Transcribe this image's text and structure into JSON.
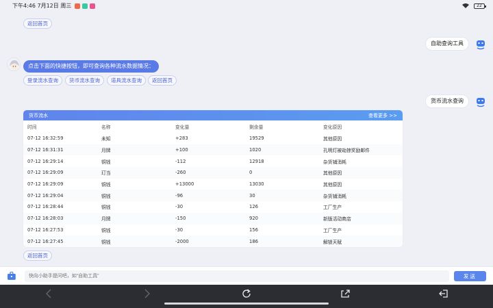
{
  "statusbar": {
    "time": "下午4:46 7月12日 周三",
    "battery": "22",
    "app_icon_colors": [
      "#f06a4a",
      "#3cc9a0",
      "#e9538f"
    ]
  },
  "chat": {
    "back_home_chip_top": "返回首页",
    "user_msg_1": "自助查询工具",
    "bot_msg": "点击下面的快捷按钮，即可查询各种流水数据情况：",
    "quick_buttons": [
      "登录流水查询",
      "货币流水查询",
      "道具流水查询",
      "返回首页"
    ],
    "user_msg_2": "货币流水查询",
    "back_home_chip_bottom": "返回首页"
  },
  "card": {
    "title": "货币流水",
    "more": "查看更多 >>",
    "columns": [
      "时间",
      "名称",
      "变化量",
      "剩余量",
      "变化原因"
    ],
    "rows": [
      [
        "07-12 16:32:59",
        "未知",
        "+283",
        "19529",
        "其他原因"
      ],
      [
        "07-12 16:31:31",
        "月牌",
        "+100",
        "1020",
        "孔明灯被劫掠奖励邮件"
      ],
      [
        "07-12 16:29:14",
        "铜钱",
        "-112",
        "12918",
        "杂货铺消耗"
      ],
      [
        "07-12 16:29:09",
        "玎当",
        "-260",
        "0",
        "其他原因"
      ],
      [
        "07-12 16:29:09",
        "铜钱",
        "+13000",
        "13030",
        "其他原因"
      ],
      [
        "07-12 16:29:04",
        "铜钱",
        "-96",
        "30",
        "杂货铺消耗"
      ],
      [
        "07-12 16:28:44",
        "铜钱",
        "-30",
        "126",
        "工厂生产"
      ],
      [
        "07-12 16:28:03",
        "月牌",
        "-150",
        "920",
        "新版活动商店"
      ],
      [
        "07-12 16:27:53",
        "铜钱",
        "-30",
        "156",
        "工厂生产"
      ],
      [
        "07-12 16:27:45",
        "铜钱",
        "-2000",
        "186",
        "解锁天赋"
      ]
    ]
  },
  "input": {
    "placeholder": "快向小助手提问吧，如“自助工具”",
    "send_label": "发送"
  },
  "colors": {
    "accent": "#5a7ae6",
    "header_gradient_start": "#5f84ec",
    "send_button": "#5a86ec"
  }
}
